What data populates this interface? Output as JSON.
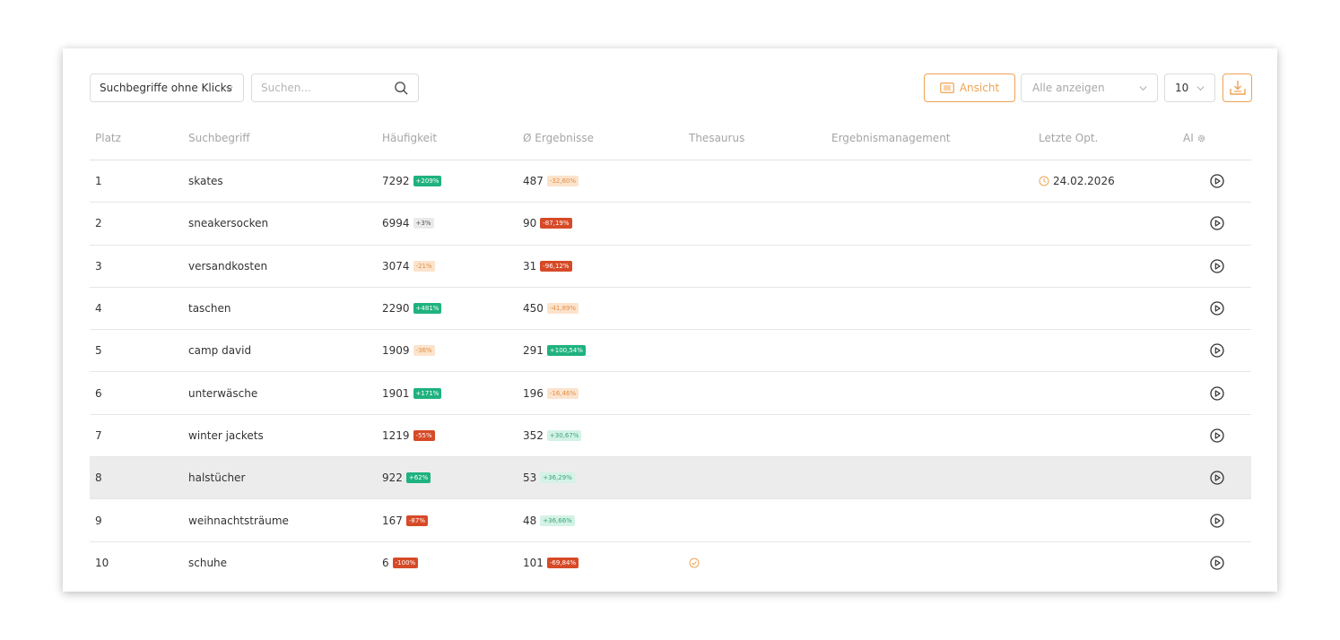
{
  "toolbar": {
    "filter_label": "Suchbegriffe ohne Klicks",
    "search_placeholder": "Suchen...",
    "view_button_label": "Ansicht",
    "show_select_label": "Alle anzeigen",
    "rows_per_page": "10"
  },
  "columns": {
    "platz": "Platz",
    "term": "Suchbegriff",
    "frequency": "Häufigkeit",
    "results": "Ø Ergebnisse",
    "thesaurus": "Thesaurus",
    "result_management": "Ergebnismanagement",
    "last_opt": "Letzte Opt.",
    "ai": "AI"
  },
  "rows": [
    {
      "rank": "1",
      "term": "skates",
      "freq": "7292",
      "freq_change": "+209%",
      "freq_style": "green",
      "results": "487",
      "results_change": "-32,60%",
      "results_style": "orange",
      "last_opt": "24.02.2026",
      "thesaurus": false
    },
    {
      "rank": "2",
      "term": "sneakersocken",
      "freq": "6994",
      "freq_change": "+3%",
      "freq_style": "gray",
      "results": "90",
      "results_change": "-87,19%",
      "results_style": "red",
      "last_opt": "",
      "thesaurus": false
    },
    {
      "rank": "3",
      "term": "versandkosten",
      "freq": "3074",
      "freq_change": "-21%",
      "freq_style": "orange",
      "results": "31",
      "results_change": "-96,12%",
      "results_style": "red",
      "last_opt": "",
      "thesaurus": false
    },
    {
      "rank": "4",
      "term": "taschen",
      "freq": "2290",
      "freq_change": "+481%",
      "freq_style": "green",
      "results": "450",
      "results_change": "-41,89%",
      "results_style": "orange",
      "last_opt": "",
      "thesaurus": false
    },
    {
      "rank": "5",
      "term": "camp david",
      "freq": "1909",
      "freq_change": "-36%",
      "freq_style": "orange",
      "results": "291",
      "results_change": "+100,54%",
      "results_style": "green",
      "last_opt": "",
      "thesaurus": false
    },
    {
      "rank": "6",
      "term": "unterwäsche",
      "freq": "1901",
      "freq_change": "+171%",
      "freq_style": "green",
      "results": "196",
      "results_change": "-16,46%",
      "results_style": "orange",
      "last_opt": "",
      "thesaurus": false
    },
    {
      "rank": "7",
      "term": "winter jackets",
      "freq": "1219",
      "freq_change": "-55%",
      "freq_style": "red",
      "results": "352",
      "results_change": "+30,67%",
      "results_style": "mint",
      "last_opt": "",
      "thesaurus": false
    },
    {
      "rank": "8",
      "term": "halstücher",
      "freq": "922",
      "freq_change": "+62%",
      "freq_style": "green",
      "results": "53",
      "results_change": "+36,29%",
      "results_style": "mint",
      "last_opt": "",
      "thesaurus": false,
      "highlighted": true
    },
    {
      "rank": "9",
      "term": "weihnachtsträume",
      "freq": "167",
      "freq_change": "-87%",
      "freq_style": "red",
      "results": "48",
      "results_change": "+36,66%",
      "results_style": "mint",
      "last_opt": "",
      "thesaurus": false
    },
    {
      "rank": "10",
      "term": "schuhe",
      "freq": "6",
      "freq_change": "-100%",
      "freq_style": "red",
      "results": "101",
      "results_change": "-69,84%",
      "results_style": "red",
      "last_opt": "",
      "thesaurus": true
    }
  ],
  "colors": {
    "accent": "#f0a356",
    "badge_green": "#1fb27f",
    "badge_red": "#d64a27",
    "highlight_row": "#ececec"
  },
  "icons": {
    "search": "search-icon",
    "view": "list-icon",
    "download": "download-icon",
    "ai_settings": "gear-icon",
    "clock": "clock-icon",
    "thesaurus": "check-circle-icon",
    "play": "play-circle-icon"
  }
}
